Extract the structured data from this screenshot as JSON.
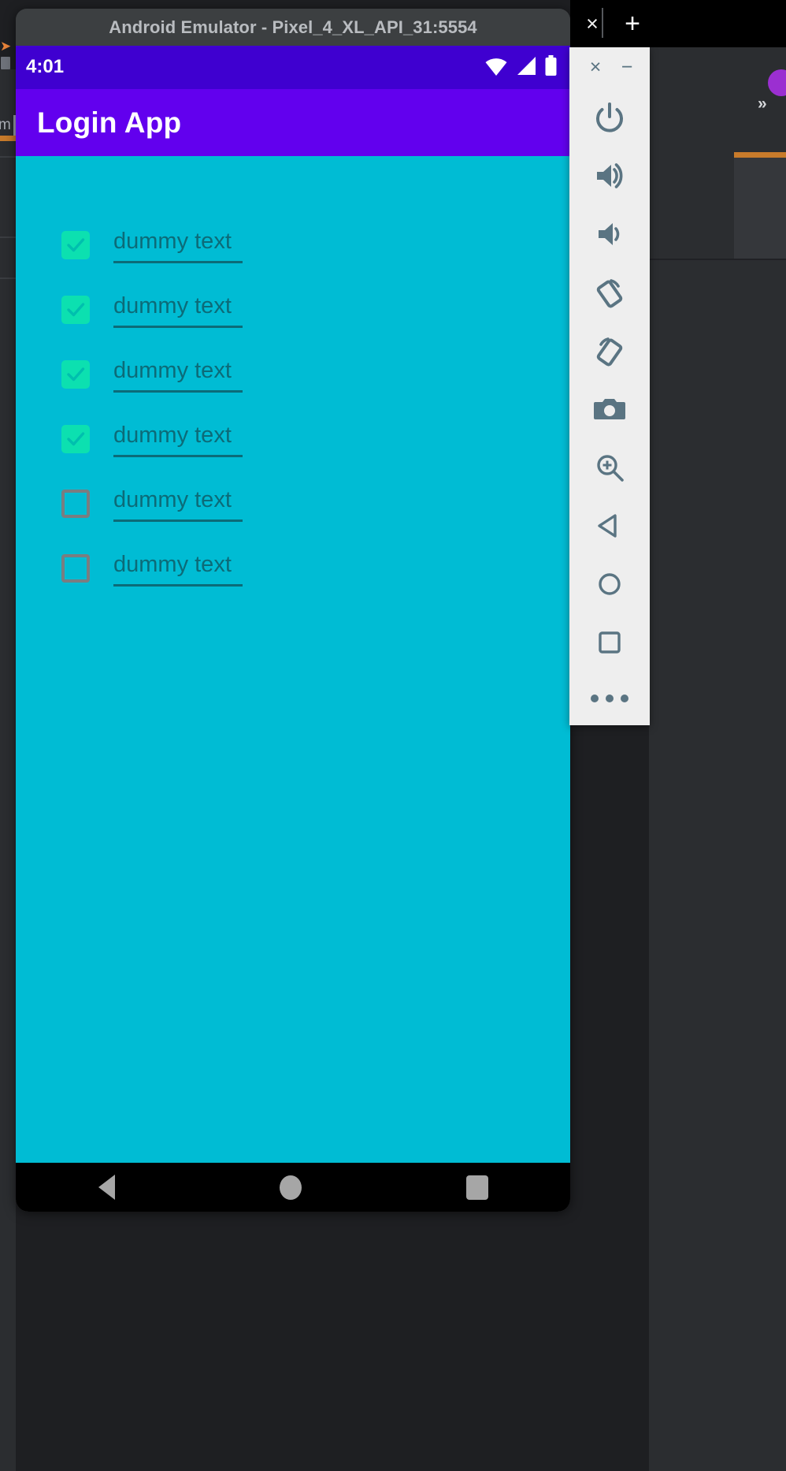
{
  "ide": {
    "left_strip_text": "m",
    "right_chevrons": "»"
  },
  "tabstrip": {
    "close_label": "×",
    "add_label": "+"
  },
  "emulator": {
    "window_title": "Android Emulator - Pixel_4_XL_API_31:5554",
    "toolbar": {
      "close_label": "×",
      "minimize_label": "−",
      "buttons": [
        {
          "name": "power-icon",
          "tooltip": "Power"
        },
        {
          "name": "volume-up-icon",
          "tooltip": "Volume Up"
        },
        {
          "name": "volume-down-icon",
          "tooltip": "Volume Down"
        },
        {
          "name": "rotate-left-icon",
          "tooltip": "Rotate Left"
        },
        {
          "name": "rotate-right-icon",
          "tooltip": "Rotate Right"
        },
        {
          "name": "camera-icon",
          "tooltip": "Take Screenshot"
        },
        {
          "name": "zoom-in-icon",
          "tooltip": "Enter Zoom Mode"
        },
        {
          "name": "back-icon",
          "tooltip": "Back"
        },
        {
          "name": "home-icon",
          "tooltip": "Home"
        },
        {
          "name": "overview-icon",
          "tooltip": "Overview"
        }
      ],
      "more_label": "⋯"
    }
  },
  "phone": {
    "status_bar": {
      "time": "4:01",
      "icons": [
        "wifi-icon",
        "cellular-signal-icon",
        "battery-icon"
      ],
      "background": "#3f00d0"
    },
    "appbar": {
      "title": "Login App",
      "background": "#6200ee",
      "text_color": "#ffffff"
    },
    "content": {
      "background": "#00bcd4",
      "checkbox_checked_color": "#0ce0b0",
      "checkbox_unchecked_color": "#7a7d80",
      "label_color": "#0c6b78",
      "rows": [
        {
          "label": "dummy text",
          "checked": true
        },
        {
          "label": "dummy text",
          "checked": true
        },
        {
          "label": "dummy text",
          "checked": true
        },
        {
          "label": "dummy text",
          "checked": true
        },
        {
          "label": "dummy text",
          "checked": false
        },
        {
          "label": "dummy text",
          "checked": false
        }
      ]
    },
    "nav_bar": {
      "background": "#000000",
      "buttons": [
        "back-icon",
        "home-icon",
        "recents-icon"
      ]
    }
  }
}
